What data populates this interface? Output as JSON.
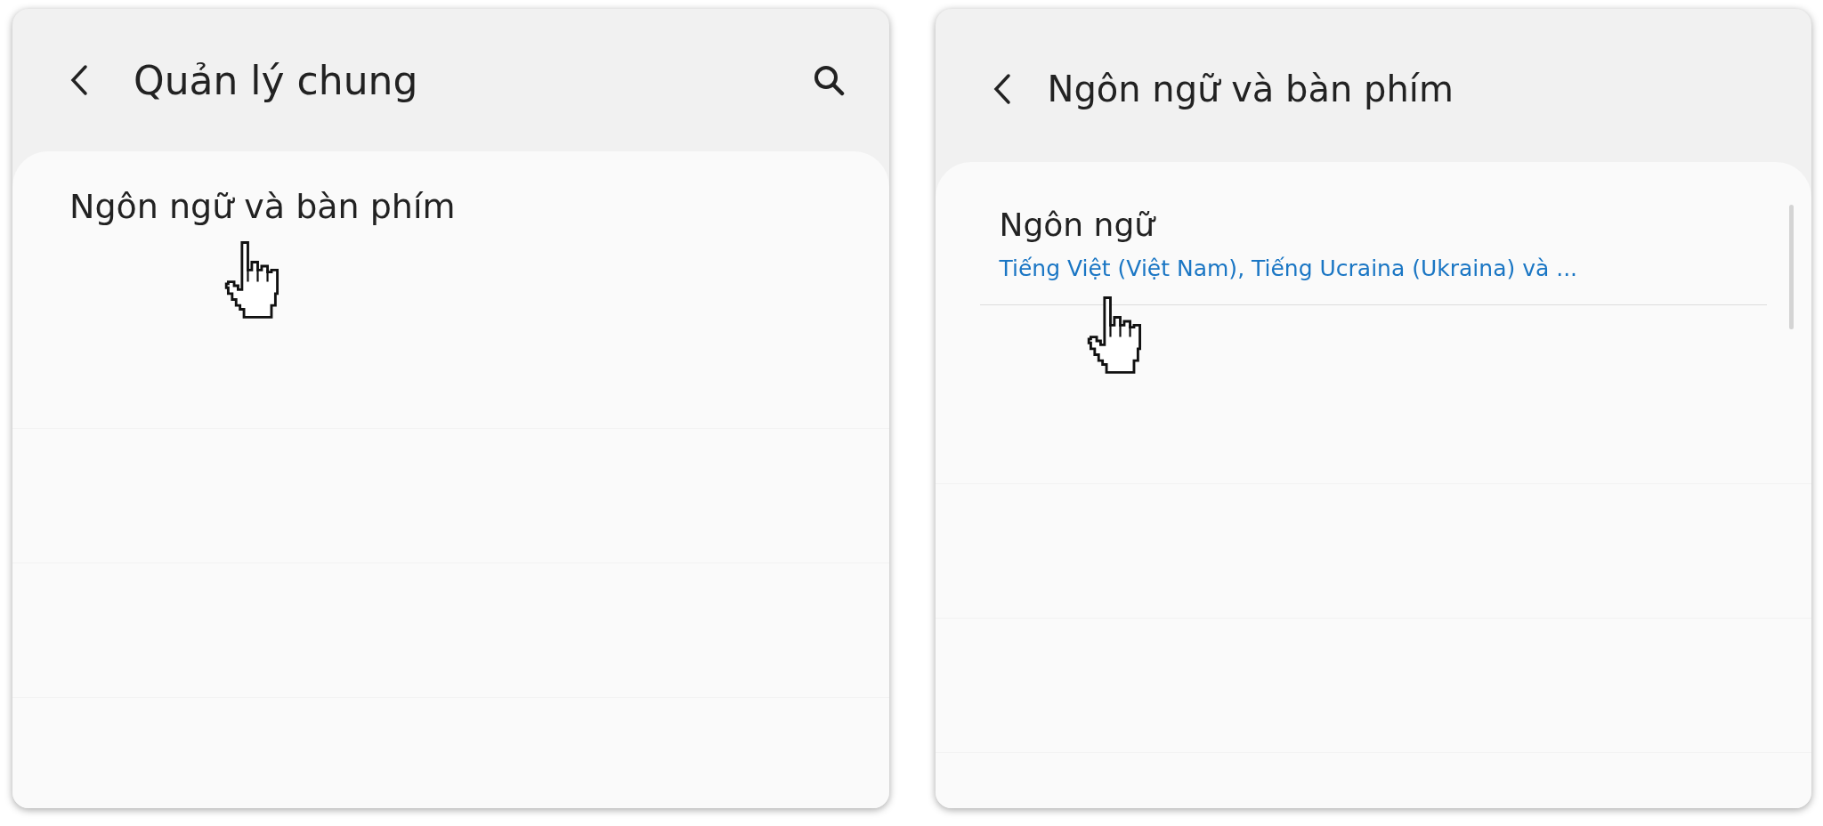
{
  "screens": [
    {
      "title": "Quản lý chung",
      "search_button": true,
      "items": [
        {
          "label": "Ngôn ngữ và bàn phím",
          "pointer": true
        }
      ]
    },
    {
      "title": "Ngôn ngữ và bàn phím",
      "search_button": false,
      "items": [
        {
          "label": "Ngôn ngữ",
          "subtitle": "Tiếng Việt (Việt Nam), Tiếng Ucraina (Ukraina) và ...",
          "pointer": true
        }
      ]
    }
  ]
}
